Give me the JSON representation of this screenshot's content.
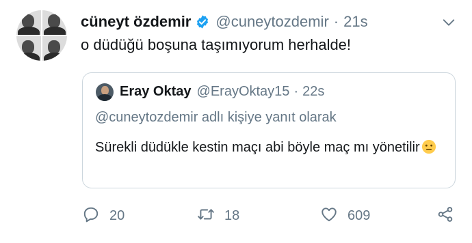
{
  "tweet": {
    "author": {
      "display_name": "cüneyt özdemir",
      "handle": "@cuneytozdemir",
      "verified_icon": "verified-badge-icon"
    },
    "separator": "·",
    "time": "21s",
    "text": "o düdüğü boşuna taşımıyorum herhalde!",
    "quoted": {
      "display_name": "Eray Oktay",
      "handle": "@ErayOktay15",
      "separator": "·",
      "time": "22s",
      "reply_context": "@cuneytozdemir adlı kişiye yanıt olarak",
      "text": "Sürekli düdükle kestin maçı abi böyle maç mı yönetilir",
      "emoji": "neutral-face-emoji"
    },
    "actions": {
      "reply_count": "20",
      "retweet_count": "18",
      "like_count": "609"
    }
  },
  "colors": {
    "text_primary": "#14171a",
    "text_secondary": "#657786",
    "verified_blue": "#1da1f2",
    "border": "#ccd6dd"
  }
}
